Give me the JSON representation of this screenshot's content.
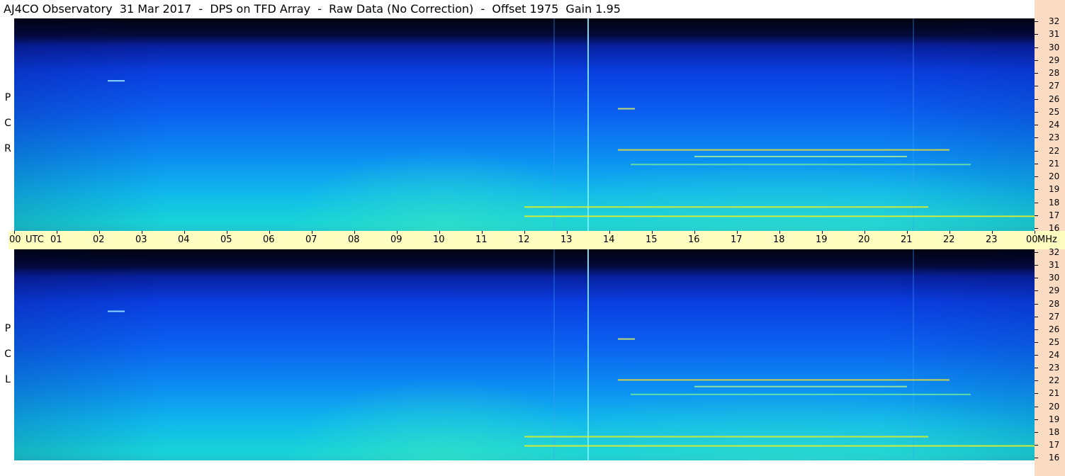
{
  "header": {
    "title": "AJ4CO Observatory  31 Mar 2017  -  DPS on TFD Array  -  Raw Data (No Correction)  -  Offset 1975  Gain 1.95"
  },
  "panels": {
    "rcp_letters": [
      "R",
      "C",
      "P"
    ],
    "lcp_letters": [
      "L",
      "C",
      "P"
    ]
  },
  "chart_data": {
    "type": "heatmap",
    "title": "AJ4CO Observatory  31 Mar 2017  -  DPS on TFD Array  -  Raw Data (No Correction)  -  Offset 1975  Gain 1.95",
    "panels": [
      "RCP",
      "LCP"
    ],
    "x_axis": {
      "unit": "UTC",
      "tick_labels": [
        "00",
        "01",
        "02",
        "03",
        "04",
        "05",
        "06",
        "07",
        "08",
        "09",
        "10",
        "11",
        "12",
        "13",
        "14",
        "15",
        "16",
        "17",
        "18",
        "19",
        "20",
        "21",
        "22",
        "23",
        "00"
      ],
      "range_hours": [
        0,
        24
      ]
    },
    "y_axis": {
      "unit": "MHz",
      "tick_labels": [
        "32",
        "31",
        "30",
        "29",
        "28",
        "27",
        "26",
        "25",
        "24",
        "23",
        "22",
        "21",
        "20",
        "19",
        "18",
        "17",
        "16"
      ],
      "range_mhz": [
        16,
        32
      ]
    },
    "colormap": [
      "#02030f",
      "#0820a0",
      "#0b60f0",
      "#10b8ec",
      "#2ee0b0",
      "#e8f020",
      "#ff40a0"
    ],
    "features": {
      "vertical_lines_utc": [
        12.7,
        13.5,
        21.15
      ],
      "horizontal_bands": [
        {
          "mhz": 17.1,
          "start_utc": 12.0,
          "end_utc": 24.0,
          "color": "#f0f020"
        },
        {
          "mhz": 17.8,
          "start_utc": 12.0,
          "end_utc": 21.5,
          "color": "#e8f020"
        },
        {
          "mhz": 22.1,
          "start_utc": 14.2,
          "end_utc": 22.0,
          "color": "#f0e030"
        },
        {
          "mhz": 21.6,
          "start_utc": 16.0,
          "end_utc": 21.0,
          "color": "#a8f090"
        },
        {
          "mhz": 21.0,
          "start_utc": 14.5,
          "end_utc": 22.5,
          "color": "#70e8a0"
        },
        {
          "mhz": 27.3,
          "start_utc": 2.2,
          "end_utc": 2.6,
          "color": "#9ff0ff"
        },
        {
          "mhz": 25.2,
          "start_utc": 14.2,
          "end_utc": 14.6,
          "color": "#e0f060"
        }
      ]
    }
  }
}
